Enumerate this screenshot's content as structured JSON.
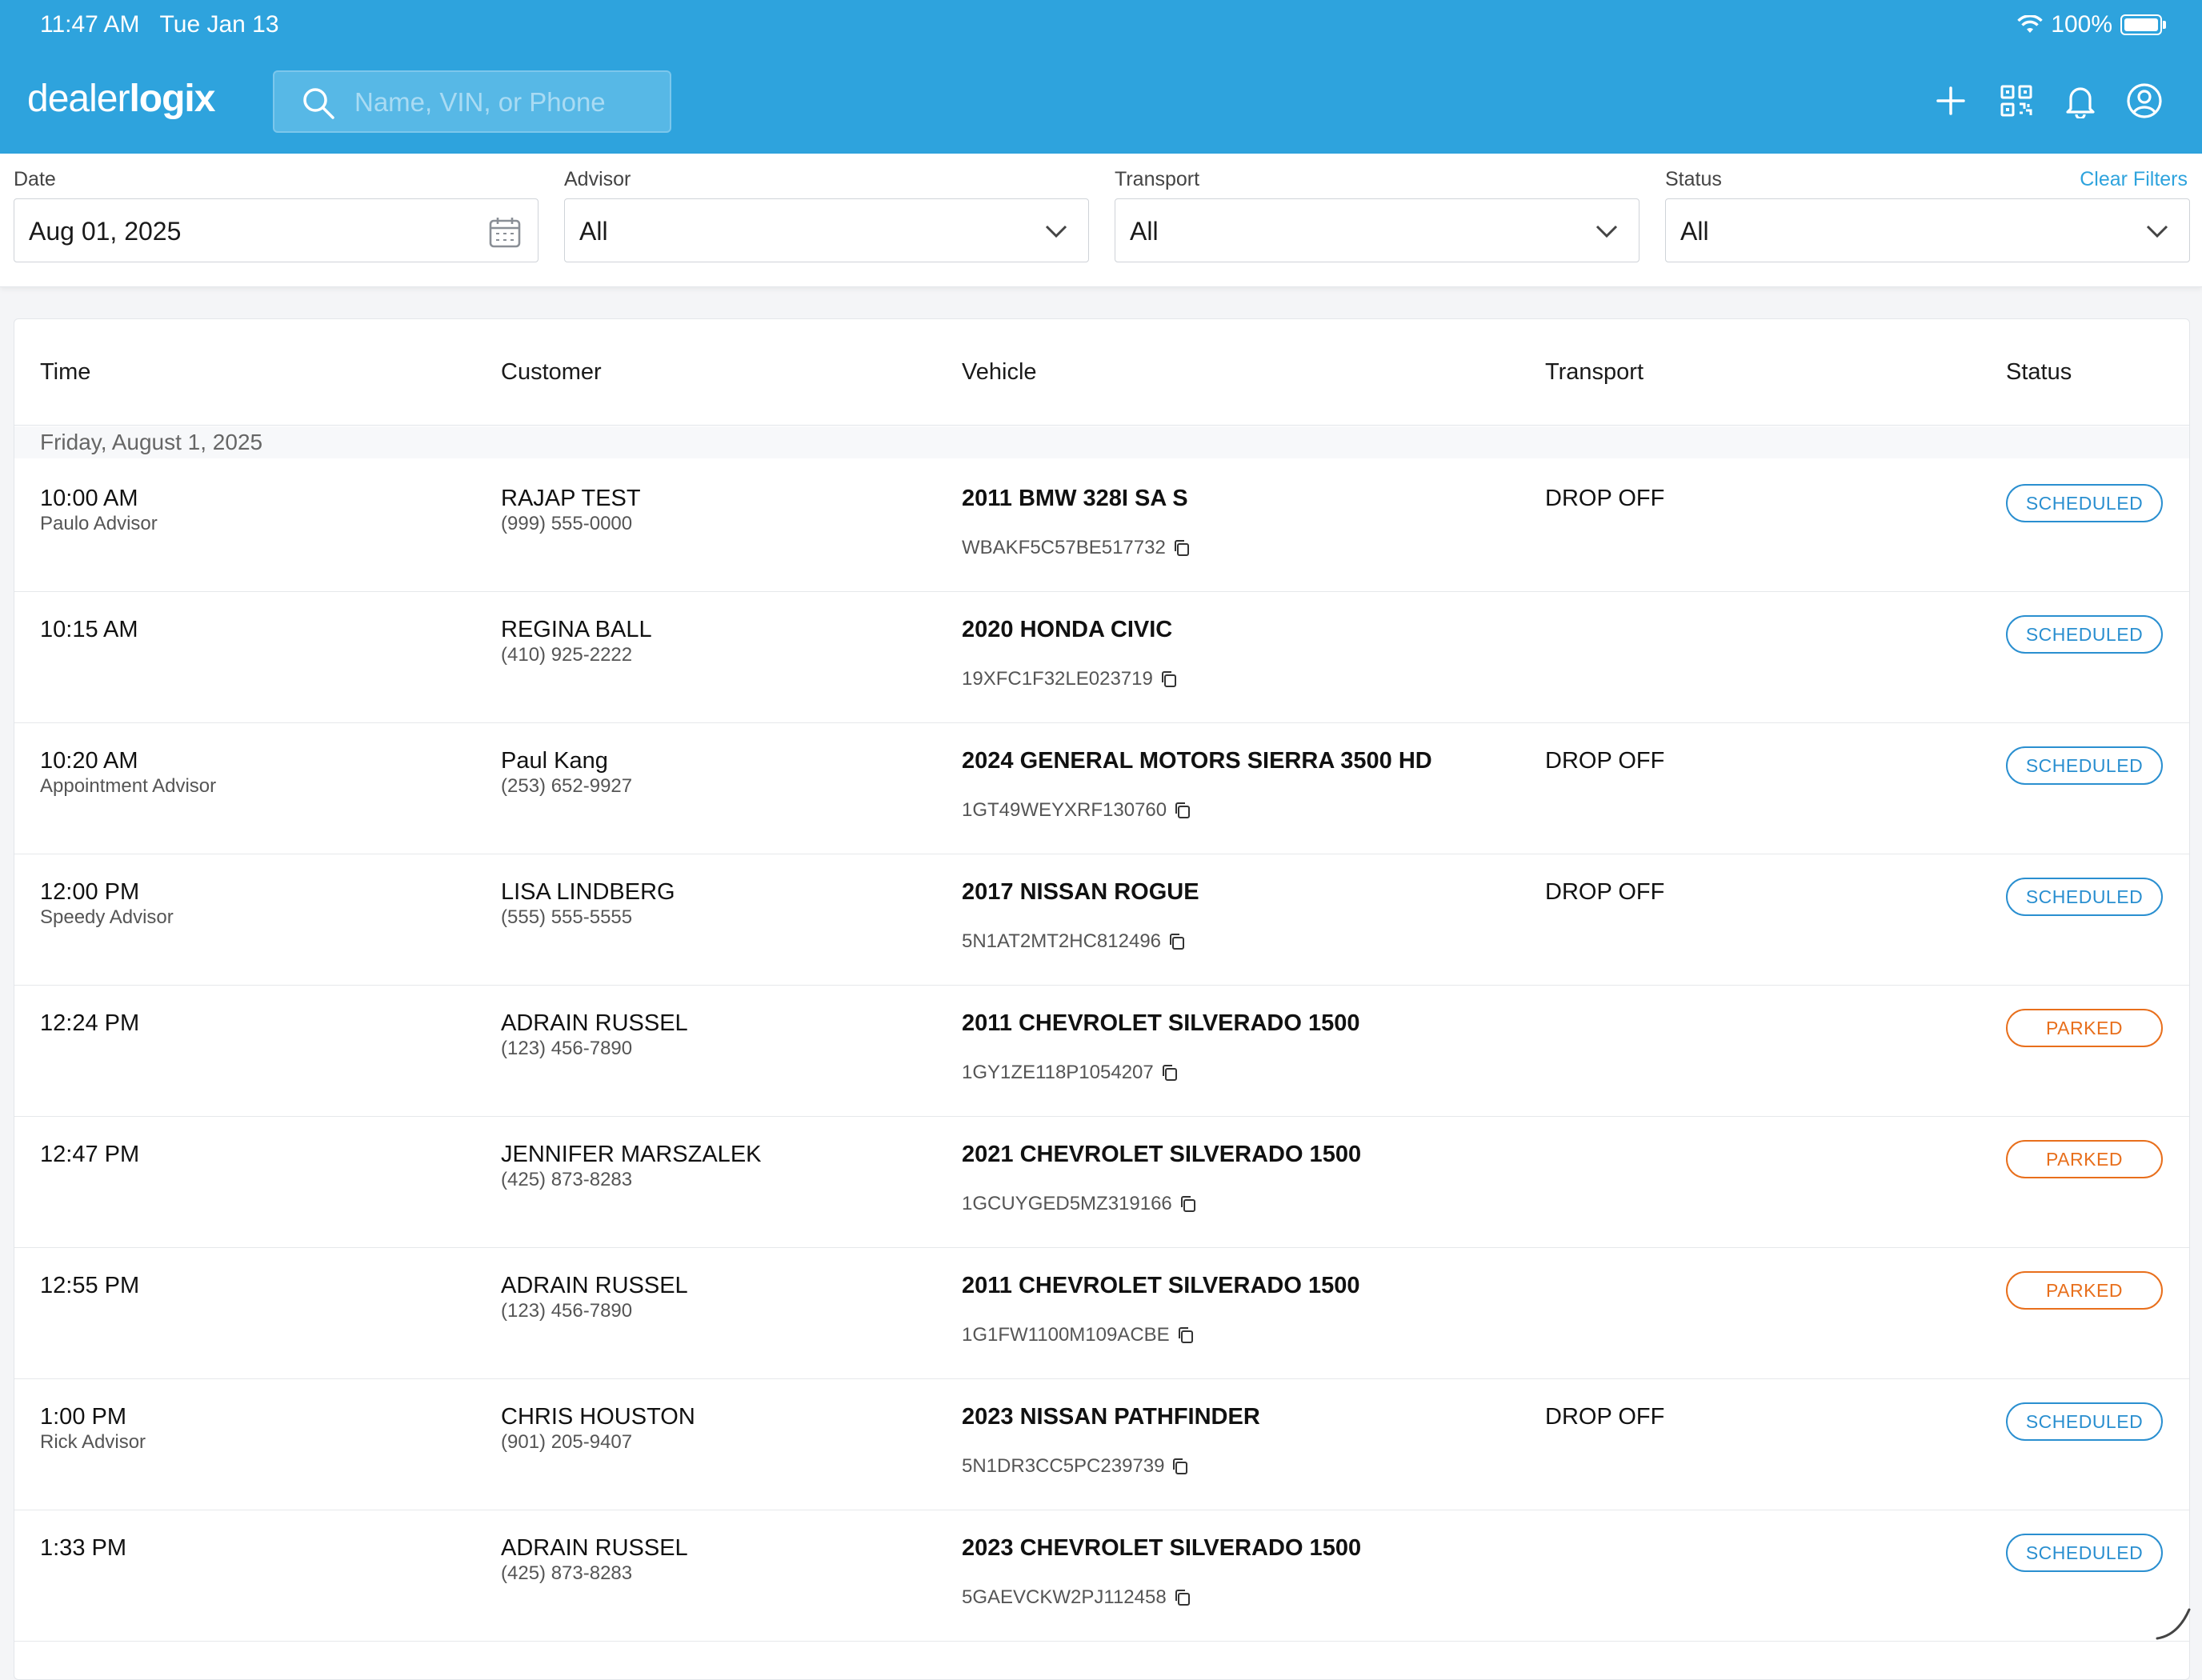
{
  "status_bar": {
    "time": "11:47 AM",
    "date": "Tue Jan 13",
    "battery": "100%"
  },
  "app": {
    "logo_light": "dealer",
    "logo_bold": "logix"
  },
  "search": {
    "placeholder": "Name, VIN, or Phone"
  },
  "header_icons": [
    "plus-icon",
    "qr-code-icon",
    "bell-icon",
    "account-icon"
  ],
  "filters": {
    "date": {
      "label": "Date",
      "value": "Aug 01, 2025"
    },
    "advisor": {
      "label": "Advisor",
      "value": "All"
    },
    "transport": {
      "label": "Transport",
      "value": "All"
    },
    "status": {
      "label": "Status",
      "value": "All"
    },
    "clear": "Clear Filters"
  },
  "table": {
    "columns": {
      "time": "Time",
      "customer": "Customer",
      "vehicle": "Vehicle",
      "transport": "Transport",
      "status": "Status"
    },
    "group_label": "Friday, August 1, 2025",
    "rows": [
      {
        "time": "10:00 AM",
        "advisor": "Paulo Advisor",
        "customer": "RAJAP TEST",
        "phone": "(999) 555-0000",
        "vehicle": "2011 BMW 328I SA S",
        "vin": "WBAKF5C57BE517732",
        "transport": "DROP OFF",
        "status": "SCHEDULED"
      },
      {
        "time": "10:15 AM",
        "advisor": "",
        "customer": "REGINA BALL",
        "phone": "(410) 925-2222",
        "vehicle": "2020 HONDA CIVIC",
        "vin": "19XFC1F32LE023719",
        "transport": "",
        "status": "SCHEDULED"
      },
      {
        "time": "10:20 AM",
        "advisor": "Appointment Advisor",
        "customer": "Paul Kang",
        "phone": "(253) 652-9927",
        "vehicle": "2024 GENERAL MOTORS SIERRA 3500 HD",
        "vin": "1GT49WEYXRF130760",
        "transport": "DROP OFF",
        "status": "SCHEDULED"
      },
      {
        "time": "12:00 PM",
        "advisor": "Speedy Advisor",
        "customer": "LISA LINDBERG",
        "phone": "(555) 555-5555",
        "vehicle": "2017 NISSAN ROGUE",
        "vin": "5N1AT2MT2HC812496",
        "transport": "DROP OFF",
        "status": "SCHEDULED"
      },
      {
        "time": "12:24 PM",
        "advisor": "",
        "customer": "ADRAIN RUSSEL",
        "phone": "(123) 456-7890",
        "vehicle": "2011 CHEVROLET SILVERADO 1500",
        "vin": "1GY1ZE118P1054207",
        "transport": "",
        "status": "PARKED"
      },
      {
        "time": "12:47 PM",
        "advisor": "",
        "customer": "JENNIFER MARSZALEK",
        "phone": "(425) 873-8283",
        "vehicle": "2021 CHEVROLET SILVERADO 1500",
        "vin": "1GCUYGED5MZ319166",
        "transport": "",
        "status": "PARKED"
      },
      {
        "time": "12:55 PM",
        "advisor": "",
        "customer": "ADRAIN RUSSEL",
        "phone": "(123) 456-7890",
        "vehicle": "2011 CHEVROLET SILVERADO 1500",
        "vin": "1G1FW1100M109ACBE",
        "transport": "",
        "status": "PARKED"
      },
      {
        "time": "1:00 PM",
        "advisor": "Rick Advisor",
        "customer": "CHRIS HOUSTON",
        "phone": "(901) 205-9407",
        "vehicle": "2023 NISSAN PATHFINDER",
        "vin": "5N1DR3CC5PC239739",
        "transport": "DROP OFF",
        "status": "SCHEDULED"
      },
      {
        "time": "1:33 PM",
        "advisor": "",
        "customer": "ADRAIN RUSSEL",
        "phone": "(425) 873-8283",
        "vehicle": "2023 CHEVROLET SILVERADO 1500",
        "vin": "5GAEVCKW2PJ112458",
        "transport": "",
        "status": "SCHEDULED"
      }
    ]
  },
  "colors": {
    "header": "#2ea3dd",
    "scheduled": "#2a8fd0",
    "parked": "#e86f1c"
  }
}
